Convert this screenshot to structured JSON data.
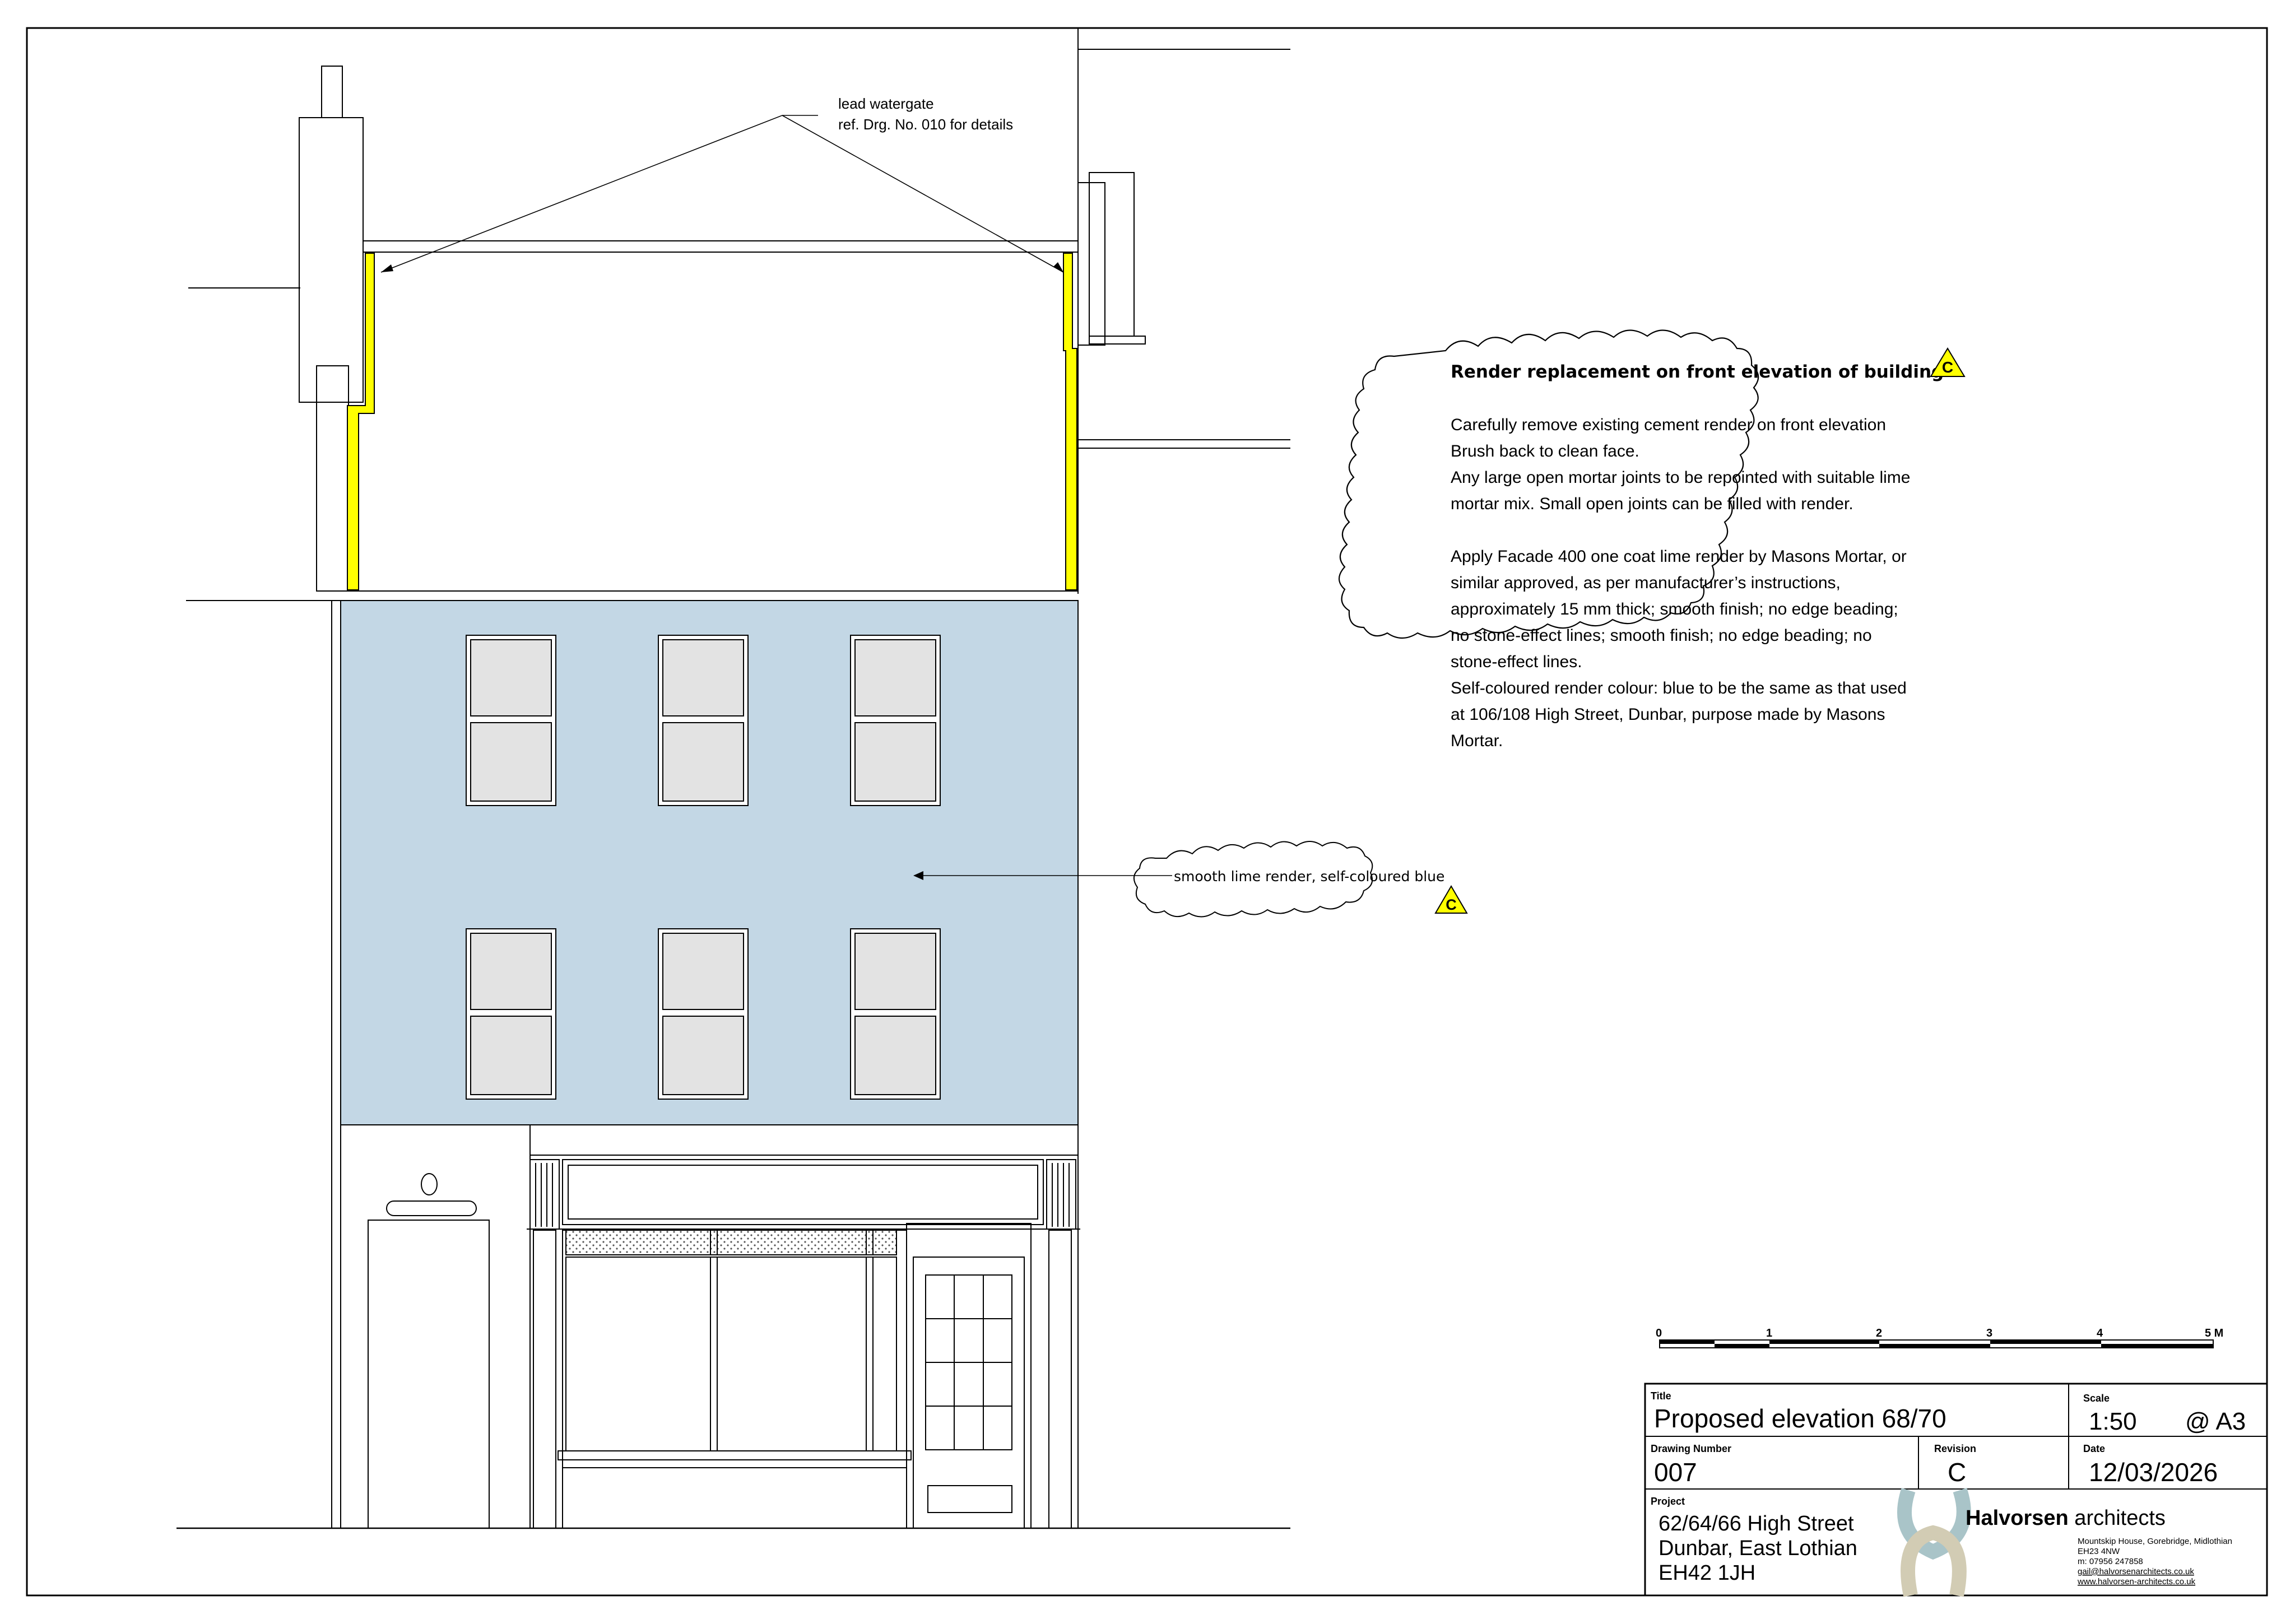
{
  "annotations": {
    "watergate": {
      "line1": "lead watergate",
      "line2": "ref. Drg. No. 010 for details"
    },
    "render_label": "smooth lime render, self-coloured blue",
    "revision_marker": "C"
  },
  "spec_note": {
    "title": "Render replacement on front elevation of building",
    "lines": [
      "Carefully remove existing cement render on front elevation",
      "Brush back to clean face.",
      "Any large open mortar joints to be repointed with suitable lime",
      "mortar mix. Small open joints can be filled with render.",
      "",
      "Apply Facade 400 one coat lime render by Masons Mortar, or",
      "similar approved, as per manufacturer’s instructions,",
      "approximately 15 mm thick; smooth finish; no edge beading;",
      "no stone-effect lines; smooth finish; no edge beading; no",
      "stone-effect lines.",
      "Self-coloured render colour: blue to be the same as that used",
      "at 106/108 High Street, Dunbar, purpose made by Masons",
      "Mortar."
    ]
  },
  "scale_bar": {
    "ticks": [
      "0",
      "1",
      "2",
      "3",
      "4",
      "5 M"
    ]
  },
  "title_block": {
    "title_label": "Title",
    "title": "Proposed elevation 68/70",
    "scale_label": "Scale",
    "scale": "1:50",
    "sheet_size": "@ A3",
    "drawing_number_label": "Drawing Number",
    "drawing_number": "007",
    "revision_label": "Revision",
    "revision": "C",
    "date_label": "Date",
    "date": "12/03/2026",
    "project_label": "Project",
    "project_lines": [
      "62/64/66 High Street",
      "Dunbar, East Lothian",
      "EH42 1JH"
    ],
    "firm_name_bold": "Halvorsen",
    "firm_name_rest": " architects",
    "address_lines": [
      "Mountskip House, Gorebridge, Midlothian",
      "EH23 4NW",
      "m: 07956 247858",
      "gail@halvorsenarchitects.co.uk",
      "www.halvorsen-architects.co.uk"
    ]
  },
  "colors": {
    "render_blue": "#c3d7e5",
    "lead_yellow": "#ffff00",
    "glass_grey": "#e3e3e3",
    "marker_yellow": "#ffff00",
    "logo_teal": "#a9c4c8",
    "logo_sand": "#d2ccb4"
  }
}
